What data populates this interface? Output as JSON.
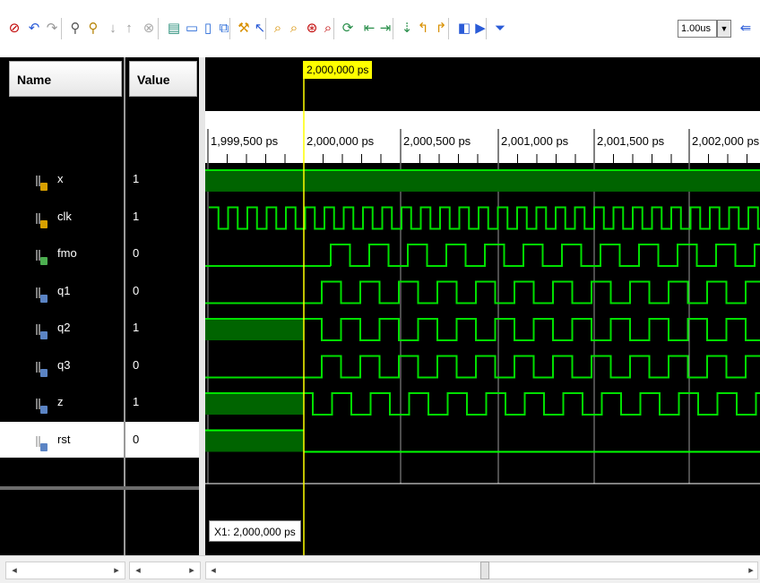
{
  "toolbar": {
    "icons": [
      "stop-red-icon",
      "undo-icon",
      "redo-icon",
      "find-icon",
      "find-next-icon",
      "move-down-icon",
      "move-up-icon",
      "delete-icon",
      "group-icon",
      "divider-icon",
      "virtual-bus-icon",
      "float-window-icon",
      "cursor-icon",
      "help-pointer-icon",
      "zoom-in-icon",
      "zoom-out-icon",
      "zoom-fit-icon",
      "zoom-cursor-icon",
      "refresh-icon",
      "go-start-icon",
      "go-end-icon",
      "add-marker-icon",
      "prev-transition-icon",
      "next-transition-icon",
      "restart-icon",
      "run-all-icon",
      "run-for-icon",
      "breakpoint-icon"
    ],
    "run_time": "1.00us",
    "run_time_dropdown": "▼"
  },
  "columns": {
    "name": "Name",
    "value": "Value"
  },
  "signals": [
    {
      "name": "x",
      "value": "1",
      "type": "input-port",
      "selected": false
    },
    {
      "name": "clk",
      "value": "1",
      "type": "input-port",
      "selected": false
    },
    {
      "name": "fmo",
      "value": "0",
      "type": "output-port",
      "selected": false
    },
    {
      "name": "q1",
      "value": "0",
      "type": "signal",
      "selected": false
    },
    {
      "name": "q2",
      "value": "1",
      "type": "signal",
      "selected": false
    },
    {
      "name": "q3",
      "value": "0",
      "type": "signal",
      "selected": false
    },
    {
      "name": "z",
      "value": "1",
      "type": "signal",
      "selected": false
    },
    {
      "name": "rst",
      "value": "0",
      "type": "signal",
      "selected": true
    }
  ],
  "timeline": {
    "ticks": [
      "1,999,500 ps",
      "2,000,000 ps",
      "2,000,500 ps",
      "2,001,000 ps",
      "2,001,500 ps",
      "2,002,000 ps"
    ],
    "cursor_time": "2,000,000 ps",
    "marker_label": "X1: 2,000,000 ps"
  },
  "colors": {
    "wave_high": "#00e000",
    "wave_fill": "#006400",
    "rst_line": "#00ff00",
    "cursor": "#ffff00",
    "background": "#000000"
  }
}
